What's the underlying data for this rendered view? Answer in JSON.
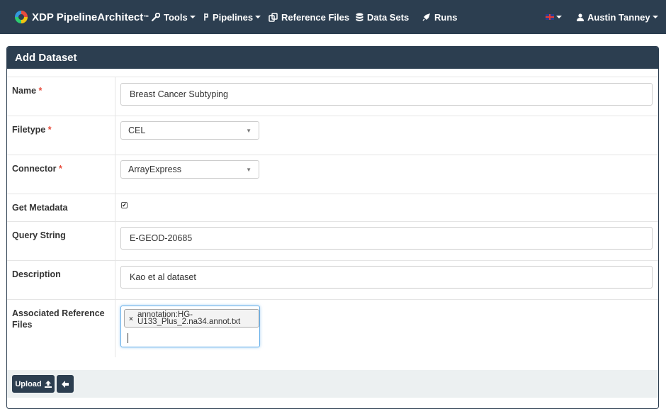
{
  "navbar": {
    "brand": "XDP PipelineArchitect",
    "brand_tm": "™",
    "items": [
      {
        "label": "Tools",
        "icon": "wrench-icon",
        "dropdown": true
      },
      {
        "label": "Pipelines",
        "icon": "pipeline-icon",
        "dropdown": true
      },
      {
        "label": "Reference Files",
        "icon": "files-icon",
        "dropdown": false
      },
      {
        "label": "Data Sets",
        "icon": "database-icon",
        "dropdown": false
      },
      {
        "label": "Runs",
        "icon": "rocket-icon",
        "dropdown": false
      }
    ],
    "language_icon": "uk-flag-icon",
    "user": "Austin Tanney"
  },
  "panel": {
    "title": "Add Dataset"
  },
  "form": {
    "name": {
      "label": "Name",
      "required": "*",
      "value": "Breast Cancer Subtyping"
    },
    "filetype": {
      "label": "Filetype",
      "required": "*",
      "value": "CEL"
    },
    "connector": {
      "label": "Connector",
      "required": "*",
      "value": "ArrayExpress"
    },
    "get_metadata": {
      "label": "Get Metadata",
      "checked": true,
      "check_glyph": "✔"
    },
    "query_string": {
      "label": "Query String",
      "value": "E-GEOD-20685"
    },
    "description": {
      "label": "Description",
      "value": "Kao et al dataset"
    },
    "reference_files": {
      "label": "Associated Reference Files",
      "selected": [
        "annotation:HG-U133_Plus_2.na34.annot.txt"
      ],
      "remove_glyph": "×"
    }
  },
  "footer": {
    "upload_label": "Upload",
    "upload_icon": "upload-icon",
    "back_icon": "arrow-left-icon"
  },
  "colors": {
    "navbar": "#2c3e50",
    "required": "#e74c3c",
    "focus_border": "#66afe9",
    "footer_bg": "#ecf0f1"
  }
}
